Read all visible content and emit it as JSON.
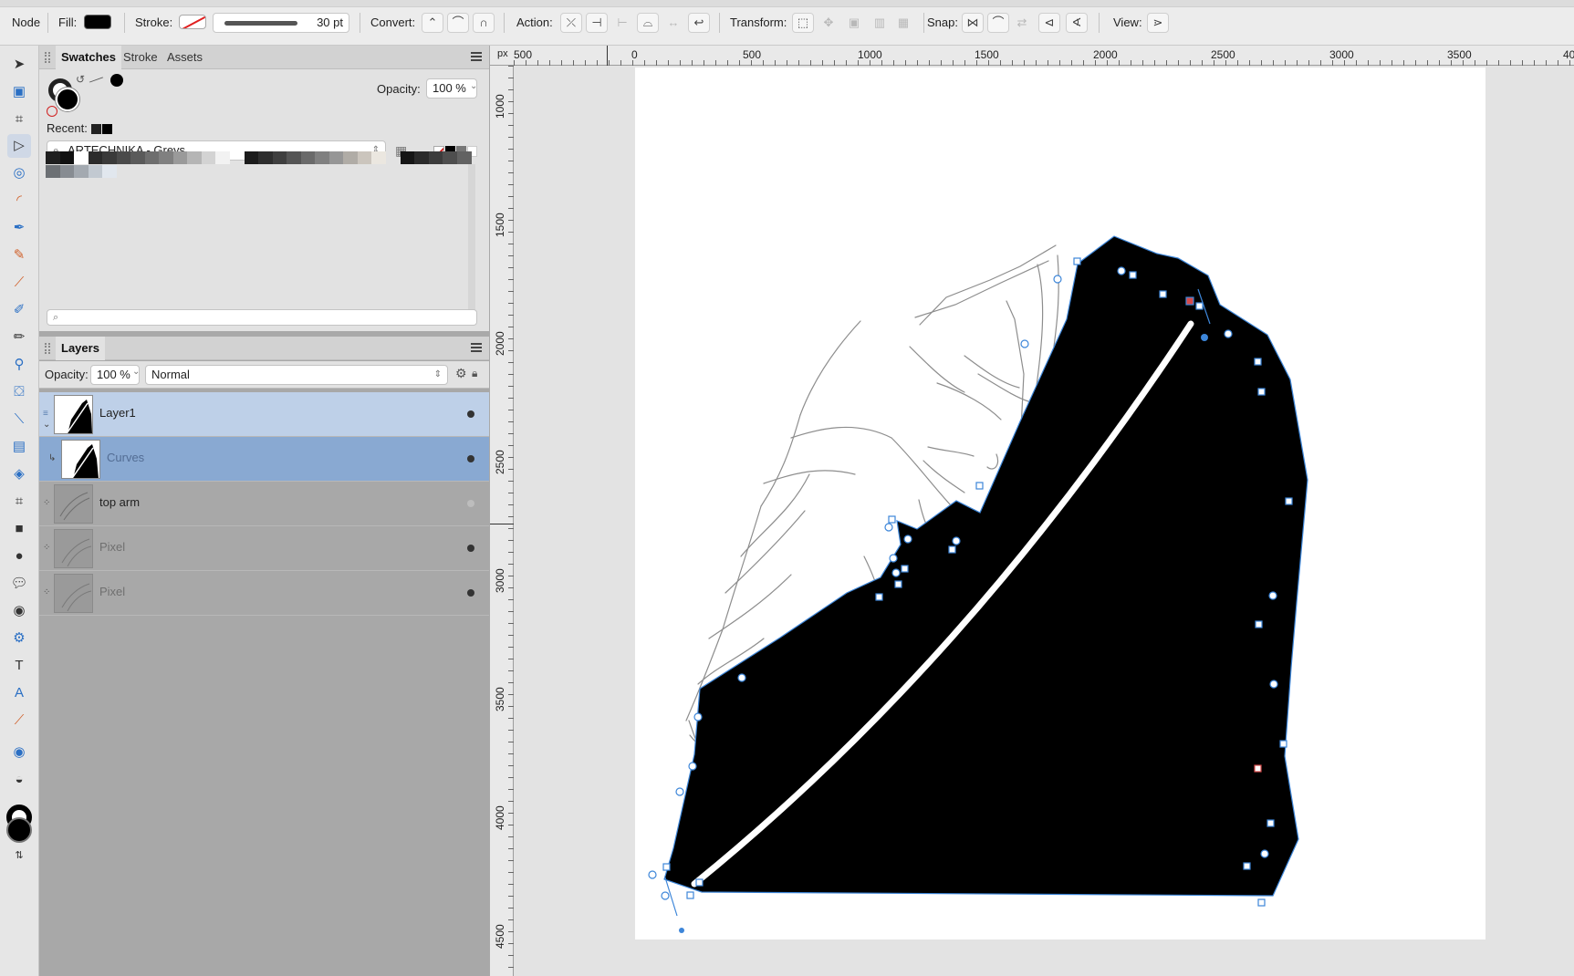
{
  "context_toolbar": {
    "mode_label": "Node",
    "fill_label": "Fill:",
    "stroke_label": "Stroke:",
    "stroke_width": "30 pt",
    "convert_label": "Convert:",
    "action_label": "Action:",
    "transform_label": "Transform:",
    "snap_label": "Snap:",
    "view_label": "View:"
  },
  "colors": {
    "fill": "#000000",
    "selection_blue": "#8aaed6",
    "path_blue": "#3d86d9"
  },
  "swatches_panel": {
    "tabs": [
      "Swatches",
      "Stroke",
      "Assets"
    ],
    "opacity_label": "Opacity:",
    "opacity_value": "100 %",
    "recent_label": "Recent:",
    "palette_name": "ARTECHNIKA - Greys",
    "palette_colors": [
      "#1f1f1f",
      "#111111",
      "#ffffff",
      "#2b2b2b",
      "#3a3a3a",
      "#4a4a4a",
      "#5a5a5a",
      "#6e6e6e",
      "#808080",
      "#9a9a9a",
      "#b5b5b5",
      "#d3d3d3",
      "#f2f2f2",
      "#1c1c1c",
      "#2e2e2e",
      "#3f3f3f",
      "#555555",
      "#6a6a6a",
      "#808080",
      "#969696",
      "#b0aca6",
      "#cbc5bd",
      "#ebe7e0",
      "#161616",
      "#2a2a2a",
      "#3c3c3c",
      "#4e4e4e",
      "#626262",
      "#6c7074",
      "#878c92",
      "#a3a9b0",
      "#c2c9d1",
      "#e1e7ee"
    ]
  },
  "layers_panel": {
    "title": "Layers",
    "opacity_label": "Opacity:",
    "opacity_value": "100 %",
    "blend_mode": "Normal",
    "layers": [
      {
        "name": "Layer1"
      },
      {
        "name": "Curves"
      },
      {
        "name": "top arm"
      },
      {
        "name": "Pixel"
      },
      {
        "name": "Pixel"
      }
    ]
  },
  "rulers": {
    "unit": "px",
    "horizontal": [
      "500",
      "0",
      "500",
      "1000",
      "1500",
      "2000",
      "2500",
      "3000",
      "3500",
      "40"
    ],
    "vertical": [
      "1000",
      "1500",
      "2000",
      "2500",
      "3000",
      "3500",
      "4000",
      "4500"
    ]
  }
}
